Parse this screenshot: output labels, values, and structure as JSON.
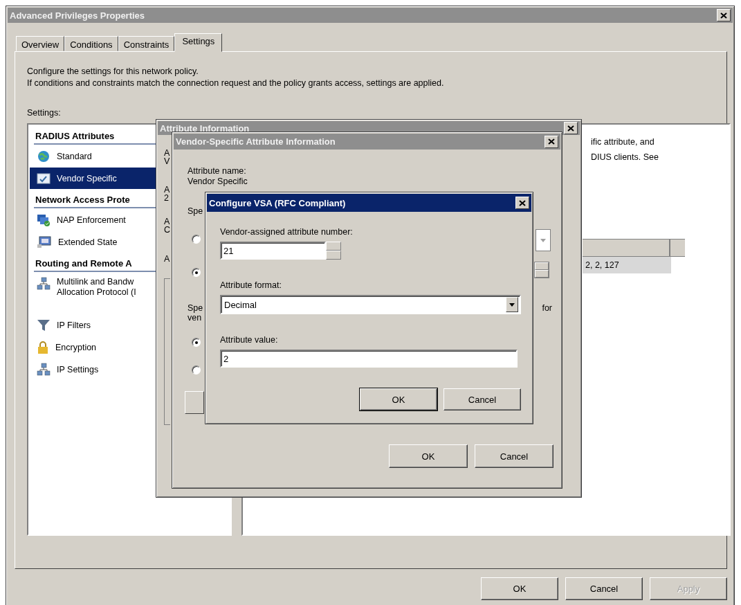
{
  "window": {
    "title": "Advanced Privileges Properties",
    "active": false
  },
  "tabs": [
    {
      "label": "Overview",
      "selected": false
    },
    {
      "label": "Conditions",
      "selected": false
    },
    {
      "label": "Constraints",
      "selected": false
    },
    {
      "label": "Settings",
      "selected": true
    }
  ],
  "description": [
    "Configure the settings for this network policy.",
    "If conditions and constraints match the connection request and the policy grants access, settings are applied."
  ],
  "settings_label": "Settings:",
  "settings_list": [
    {
      "kind": "header",
      "label": "RADIUS Attributes"
    },
    {
      "kind": "item",
      "label": "Standard",
      "selected": false
    },
    {
      "kind": "item",
      "label": "Vendor Specific",
      "selected": true
    },
    {
      "kind": "header",
      "label": "Network Access Prote"
    },
    {
      "kind": "item",
      "label": "NAP Enforcement",
      "selected": false
    },
    {
      "kind": "item",
      "label": "Extended State",
      "selected": false
    },
    {
      "kind": "header",
      "label": "Routing and Remote A"
    },
    {
      "kind": "item",
      "label": "Multilink and Bandw\nAllocation Protocol (I",
      "selected": false
    },
    {
      "kind": "item",
      "label": "IP Filters",
      "selected": false
    },
    {
      "kind": "item",
      "label": "Encryption",
      "selected": false
    },
    {
      "kind": "item",
      "label": "IP Settings",
      "selected": false
    }
  ],
  "right_panel": {
    "text": "ific attribute, and\nDIUS clients. See",
    "table_rows": [
      {
        "cell": "2, 2, 127",
        "selected": true
      }
    ]
  },
  "buttons": [
    {
      "label": "OK",
      "disabled": false
    },
    {
      "label": "Cancel",
      "disabled": false
    },
    {
      "label": "Apply",
      "disabled": true
    }
  ],
  "attribute_info_dialog": {
    "title": "Attribute Information",
    "active": false,
    "fragments": [
      "A\nV",
      "A\n2",
      "A\nC",
      "A"
    ]
  },
  "vsa_info_dialog": {
    "title": "Vendor-Specific Attribute Information",
    "active": false,
    "attribute_name_label": "Attribute name:",
    "attribute_name": "Vendor Specific",
    "fragment_1": "Spe",
    "radios_1": [
      {
        "selected": false
      },
      {
        "selected": true
      }
    ],
    "fragment_2": "Spe\nven",
    "fragment_3": "for",
    "radios_2": [
      {
        "selected": true
      },
      {
        "selected": false
      }
    ],
    "buttons": [
      {
        "label": "OK"
      },
      {
        "label": "Cancel"
      }
    ]
  },
  "configure_vsa_dialog": {
    "title": "Configure VSA (RFC Compliant)",
    "active": true,
    "number_label": "Vendor-assigned attribute number:",
    "number_value": "21",
    "format_label": "Attribute format:",
    "format_value": "Decimal",
    "value_label": "Attribute value:",
    "value": "2",
    "buttons": [
      {
        "label": "OK",
        "default": true
      },
      {
        "label": "Cancel",
        "default": false
      }
    ]
  }
}
